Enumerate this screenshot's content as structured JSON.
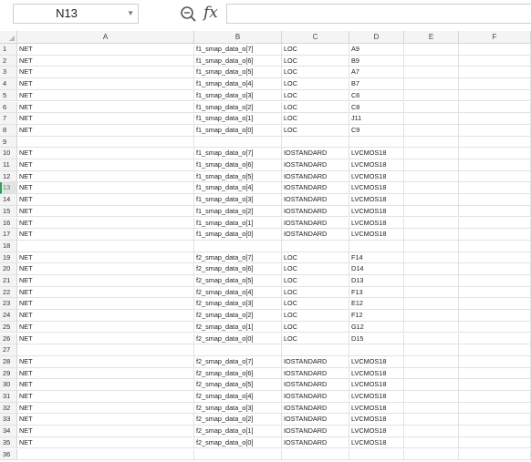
{
  "name_box": {
    "value": "N13"
  },
  "formula_bar": {
    "fx_label": "fx",
    "value": ""
  },
  "columns": [
    "A",
    "B",
    "C",
    "D",
    "E",
    "F"
  ],
  "active_row": 13,
  "rows": [
    {
      "n": "1",
      "a": "NET",
      "b": "f1_smap_data_o[7]",
      "c": "LOC",
      "d": "A9"
    },
    {
      "n": "2",
      "a": "NET",
      "b": "f1_smap_data_o[6]",
      "c": "LOC",
      "d": "B9"
    },
    {
      "n": "3",
      "a": "NET",
      "b": "f1_smap_data_o[5]",
      "c": "LOC",
      "d": "A7"
    },
    {
      "n": "4",
      "a": "NET",
      "b": "f1_smap_data_o[4]",
      "c": "LOC",
      "d": "B7"
    },
    {
      "n": "5",
      "a": "NET",
      "b": "f1_smap_data_o[3]",
      "c": "LOC",
      "d": "C6"
    },
    {
      "n": "6",
      "a": "NET",
      "b": "f1_smap_data_o[2]",
      "c": "LOC",
      "d": "C8"
    },
    {
      "n": "7",
      "a": "NET",
      "b": "f1_smap_data_o[1]",
      "c": "LOC",
      "d": "J11"
    },
    {
      "n": "8",
      "a": "NET",
      "b": "f1_smap_data_o[0]",
      "c": "LOC",
      "d": "C9"
    },
    {
      "n": "9",
      "a": "",
      "b": "",
      "c": "",
      "d": ""
    },
    {
      "n": "10",
      "a": "NET",
      "b": "f1_smap_data_o[7]",
      "c": "IOSTANDARD",
      "d": "LVCMOS18"
    },
    {
      "n": "11",
      "a": "NET",
      "b": "f1_smap_data_o[6]",
      "c": "IOSTANDARD",
      "d": "LVCMOS18"
    },
    {
      "n": "12",
      "a": "NET",
      "b": "f1_smap_data_o[5]",
      "c": "IOSTANDARD",
      "d": "LVCMOS18"
    },
    {
      "n": "13",
      "a": "NET",
      "b": "f1_smap_data_o[4]",
      "c": "IOSTANDARD",
      "d": "LVCMOS18"
    },
    {
      "n": "14",
      "a": "NET",
      "b": "f1_smap_data_o[3]",
      "c": "IOSTANDARD",
      "d": "LVCMOS18"
    },
    {
      "n": "15",
      "a": "NET",
      "b": "f1_smap_data_o[2]",
      "c": "IOSTANDARD",
      "d": "LVCMOS18"
    },
    {
      "n": "16",
      "a": "NET",
      "b": "f1_smap_data_o[1]",
      "c": "IOSTANDARD",
      "d": "LVCMOS18"
    },
    {
      "n": "17",
      "a": "NET",
      "b": "f1_smap_data_o[0]",
      "c": "IOSTANDARD",
      "d": "LVCMOS18"
    },
    {
      "n": "18",
      "a": "",
      "b": "",
      "c": "",
      "d": ""
    },
    {
      "n": "19",
      "a": "NET",
      "b": "f2_smap_data_o[7]",
      "c": "LOC",
      "d": "F14"
    },
    {
      "n": "20",
      "a": "NET",
      "b": "f2_smap_data_o[6]",
      "c": "LOC",
      "d": "D14"
    },
    {
      "n": "21",
      "a": "NET",
      "b": "f2_smap_data_o[5]",
      "c": "LOC",
      "d": "D13"
    },
    {
      "n": "22",
      "a": "NET",
      "b": "f2_smap_data_o[4]",
      "c": "LOC",
      "d": "F13"
    },
    {
      "n": "23",
      "a": "NET",
      "b": "f2_smap_data_o[3]",
      "c": "LOC",
      "d": "E12"
    },
    {
      "n": "24",
      "a": "NET",
      "b": "f2_smap_data_o[2]",
      "c": "LOC",
      "d": "F12"
    },
    {
      "n": "25",
      "a": "NET",
      "b": "f2_smap_data_o[1]",
      "c": "LOC",
      "d": "G12"
    },
    {
      "n": "26",
      "a": "NET",
      "b": "f2_smap_data_o[0]",
      "c": "LOC",
      "d": "D15"
    },
    {
      "n": "27",
      "a": "",
      "b": "",
      "c": "",
      "d": ""
    },
    {
      "n": "28",
      "a": "NET",
      "b": "f2_smap_data_o[7]",
      "c": "IOSTANDARD",
      "d": "LVCMOS18"
    },
    {
      "n": "29",
      "a": "NET",
      "b": "f2_smap_data_o[6]",
      "c": "IOSTANDARD",
      "d": "LVCMOS18"
    },
    {
      "n": "30",
      "a": "NET",
      "b": "f2_smap_data_o[5]",
      "c": "IOSTANDARD",
      "d": "LVCMOS18"
    },
    {
      "n": "31",
      "a": "NET",
      "b": "f2_smap_data_o[4]",
      "c": "IOSTANDARD",
      "d": "LVCMOS18"
    },
    {
      "n": "32",
      "a": "NET",
      "b": "f2_smap_data_o[3]",
      "c": "IOSTANDARD",
      "d": "LVCMOS18"
    },
    {
      "n": "33",
      "a": "NET",
      "b": "f2_smap_data_o[2]",
      "c": "IOSTANDARD",
      "d": "LVCMOS18"
    },
    {
      "n": "34",
      "a": "NET",
      "b": "f2_smap_data_o[1]",
      "c": "IOSTANDARD",
      "d": "LVCMOS18"
    },
    {
      "n": "35",
      "a": "NET",
      "b": "f2_smap_data_o[0]",
      "c": "IOSTANDARD",
      "d": "LVCMOS18"
    },
    {
      "n": "36",
      "a": "",
      "b": "",
      "c": "",
      "d": ""
    }
  ]
}
